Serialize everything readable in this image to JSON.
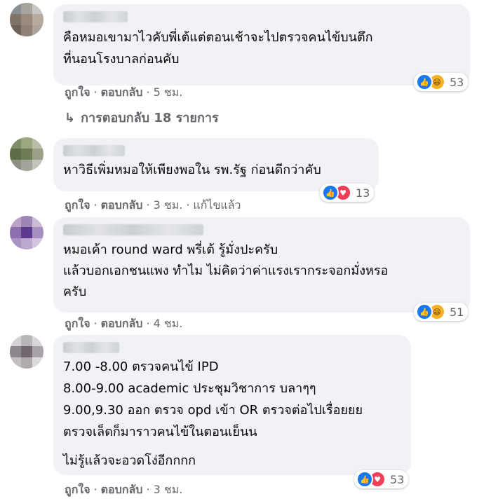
{
  "comments": [
    {
      "text": "คือหมอเขามาไวคับพี่เต้แต่ตอนเช้าจะไปตรวจคนไข้บนตึก\nที่นอนโรงบาลก่อนคับ",
      "reactions": {
        "types": [
          "like-icon",
          "haha-icon"
        ],
        "count": "53"
      },
      "actions": {
        "like": "ถูกใจ",
        "reply": "ตอบกลับ",
        "time": "5 ชม."
      },
      "replies_label": "การตอบกลับ 18 รายการ"
    },
    {
      "text": "หาวิธีเพิ่มหมอให้เพียงพอใน รพ.รัฐ ก่อนดีกว่าคับ",
      "reactions": {
        "types": [
          "like-icon",
          "love-icon"
        ],
        "count": "13"
      },
      "actions": {
        "like": "ถูกใจ",
        "reply": "ตอบกลับ",
        "time": "3 ชม.",
        "edited": "แก้ไขแล้ว"
      }
    },
    {
      "text": "หมอเค้า round ward พรี่เต้ รู้มั่งปะครับ\nแล้วบอกเอกชนแพง ทำไม ไม่คิดว่าค่าแรงเรากระจอกมั่งหรอ\nครับ",
      "reactions": {
        "types": [
          "like-icon",
          "haha-icon"
        ],
        "count": "51"
      },
      "actions": {
        "like": "ถูกใจ",
        "reply": "ตอบกลับ",
        "time": "4 ชม."
      }
    },
    {
      "text": "7.00 -8.00 ตรวจคนไข้ IPD\n8.00-9.00 academic ประชุมวิชาการ บลาๆๆ\n9.00,9.30 ออก ตรวจ opd เข้า OR ตรวจต่อไปเรื่อยยย\nตรวจเล็ดก็มาราวคนไข้ในตอนเย็นน",
      "text2": "ไม่รู้แล้วจะอวดโง่อีกกกก",
      "reactions": {
        "types": [
          "like-icon",
          "love-icon"
        ],
        "count": "53"
      },
      "actions": {
        "like": "ถูกใจ",
        "reply": "ตอบกลับ",
        "time": "3 ชม."
      }
    }
  ],
  "colors": {
    "bubble": "#f0f2f5",
    "meta": "#65676b",
    "like": "#1877f2",
    "love": "#f33e58",
    "haha": "#f7b125"
  }
}
